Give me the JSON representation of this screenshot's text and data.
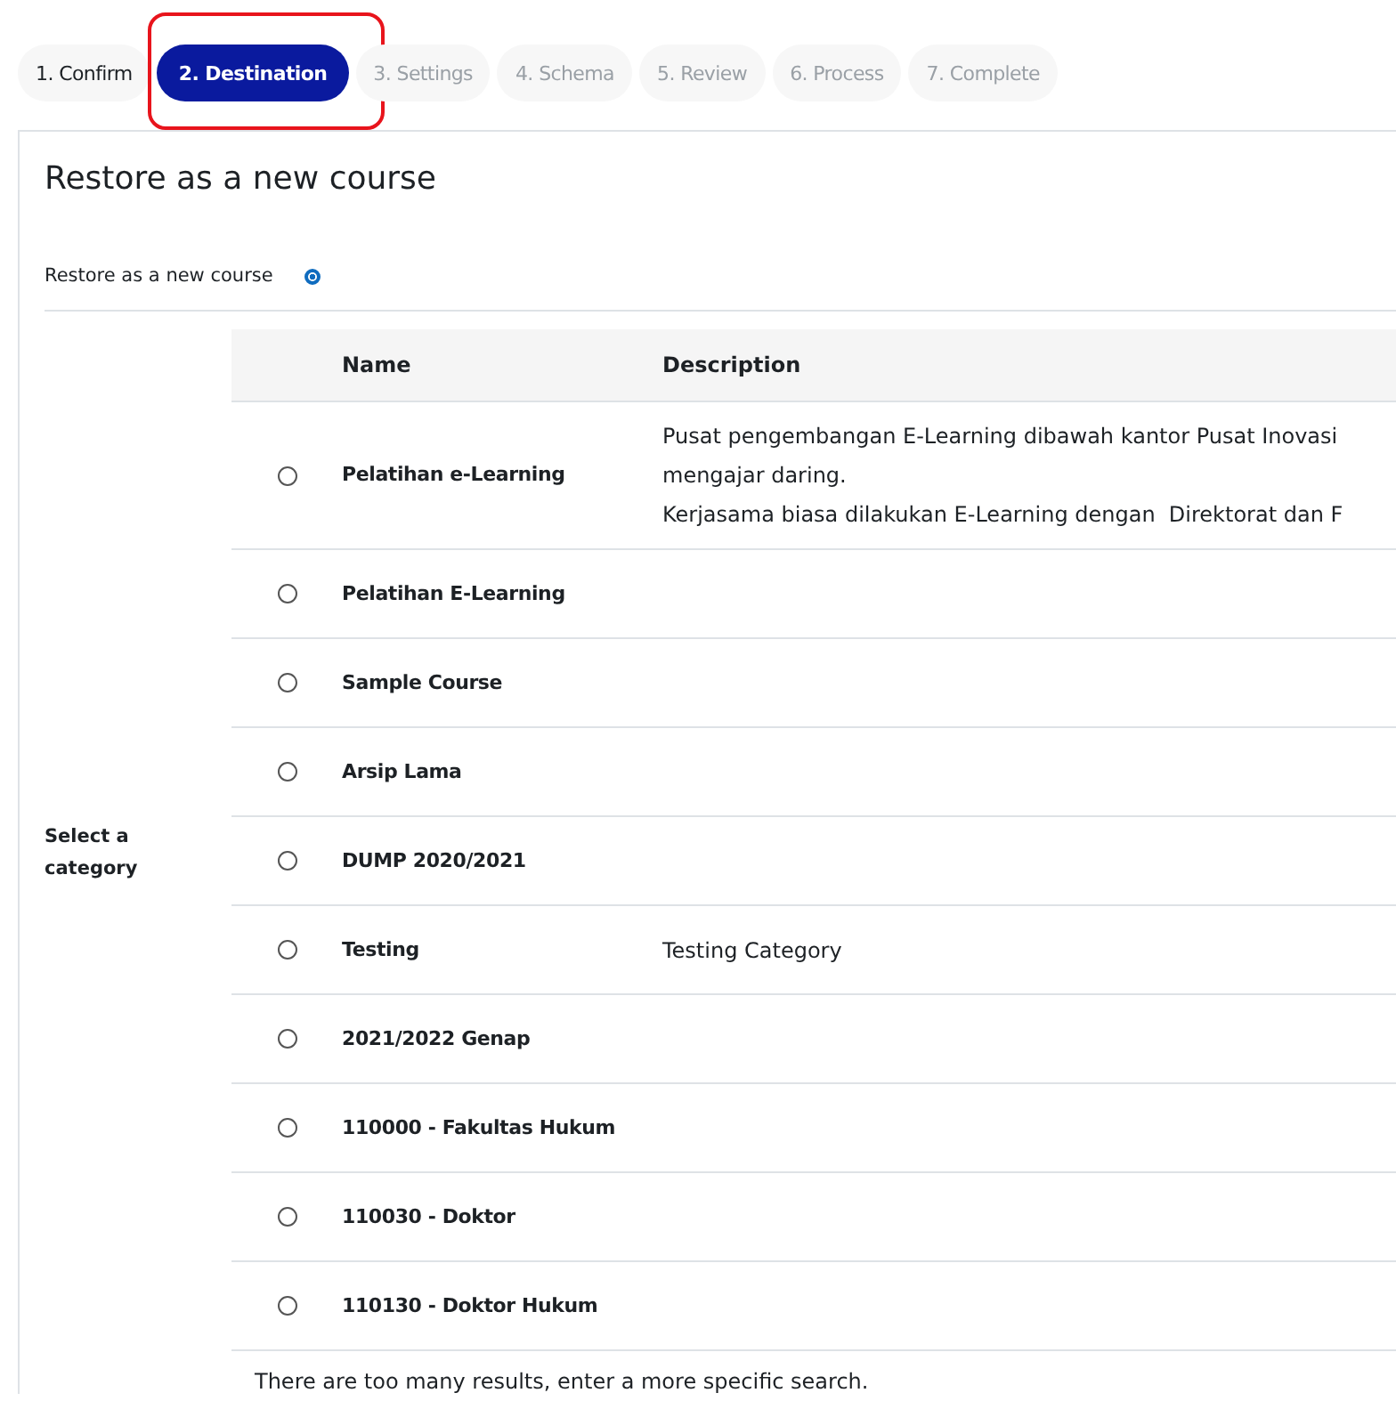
{
  "steps": [
    {
      "label": "1. Confirm",
      "selected": false,
      "done": true,
      "highlighted": false
    },
    {
      "label": "2. Destination",
      "selected": true,
      "done": false,
      "highlighted": true
    },
    {
      "label": "3. Settings",
      "selected": false,
      "done": false,
      "highlighted": false
    },
    {
      "label": "4. Schema",
      "selected": false,
      "done": false,
      "highlighted": false
    },
    {
      "label": "5. Review",
      "selected": false,
      "done": false,
      "highlighted": false
    },
    {
      "label": "6. Process",
      "selected": false,
      "done": false,
      "highlighted": false
    },
    {
      "label": "7. Complete",
      "selected": false,
      "done": false,
      "highlighted": false
    }
  ],
  "section": {
    "title": "Restore as a new course",
    "restore_option": {
      "label": "Restore as a new course",
      "selected": true
    },
    "category_label": "Select a category",
    "table": {
      "columns": [
        "Name",
        "Description"
      ],
      "rows": [
        {
          "selected": false,
          "name": "Pelatihan e-Learning",
          "description": [
            "Pusat pengembangan E-Learning dibawah kantor Pusat Inovasi",
            "mengajar daring.",
            "Kerjasama biasa dilakukan E-Learning dengan  Direktorat dan F"
          ]
        },
        {
          "selected": false,
          "name": "Pelatihan E-Learning",
          "description": []
        },
        {
          "selected": false,
          "name": "Sample Course",
          "description": []
        },
        {
          "selected": false,
          "name": "Arsip Lama",
          "description": []
        },
        {
          "selected": false,
          "name": "DUMP 2020/2021",
          "description": []
        },
        {
          "selected": false,
          "name": "Testing",
          "description": [
            "Testing Category"
          ]
        },
        {
          "selected": false,
          "name": "2021/2022 Genap",
          "description": []
        },
        {
          "selected": false,
          "name": "110000 - Fakultas Hukum",
          "description": []
        },
        {
          "selected": false,
          "name": "110030 - Doktor",
          "description": []
        },
        {
          "selected": false,
          "name": "110130 - Doktor Hukum",
          "description": []
        }
      ]
    },
    "message": "There are too many results, enter a more specific search."
  }
}
